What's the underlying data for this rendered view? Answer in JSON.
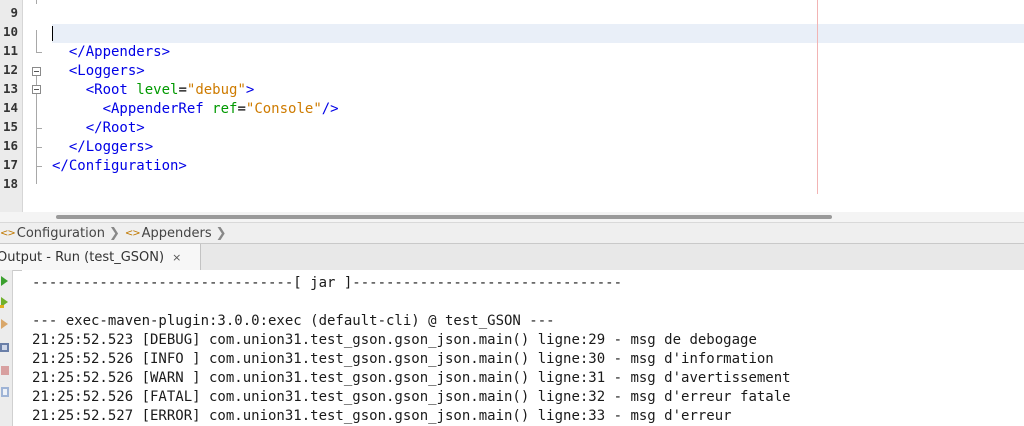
{
  "editor": {
    "line_numbers": [
      "9",
      "10",
      "11",
      "12",
      "13",
      "14",
      "15",
      "16",
      "17",
      "18"
    ],
    "lines": [
      {
        "indent": "",
        "parts": []
      },
      {
        "indent": "",
        "parts": [],
        "caret": true
      },
      {
        "indent": "  ",
        "parts": [
          {
            "c": "tag",
            "t": "</Appenders>"
          }
        ]
      },
      {
        "indent": "  ",
        "parts": [
          {
            "c": "tag",
            "t": "<Loggers>"
          }
        ]
      },
      {
        "indent": "    ",
        "parts": [
          {
            "c": "tag",
            "t": "<Root "
          },
          {
            "c": "attr",
            "t": "level"
          },
          {
            "c": "plain",
            "t": "="
          },
          {
            "c": "val",
            "t": "\"debug\""
          },
          {
            "c": "tag",
            "t": ">"
          }
        ]
      },
      {
        "indent": "      ",
        "parts": [
          {
            "c": "tag",
            "t": "<AppenderRef "
          },
          {
            "c": "attr",
            "t": "ref"
          },
          {
            "c": "plain",
            "t": "="
          },
          {
            "c": "val",
            "t": "\"Console\""
          },
          {
            "c": "tag",
            "t": "/>"
          }
        ]
      },
      {
        "indent": "    ",
        "parts": [
          {
            "c": "tag",
            "t": "</Root>"
          }
        ]
      },
      {
        "indent": "  ",
        "parts": [
          {
            "c": "tag",
            "t": "</Loggers>"
          }
        ]
      },
      {
        "indent": "",
        "parts": [
          {
            "c": "tag",
            "t": "</Configuration>"
          }
        ]
      },
      {
        "indent": "",
        "parts": []
      }
    ]
  },
  "breadcrumb": {
    "items": [
      {
        "icon": "xml-element-icon",
        "label": "Configuration"
      },
      {
        "icon": "xml-element-icon",
        "label": "Appenders"
      }
    ]
  },
  "output": {
    "tab_label": "Output - Run (test_GSON)",
    "close_glyph": "×",
    "lines": [
      "-------------------------------[ jar ]--------------------------------",
      "",
      "--- exec-maven-plugin:3.0.0:exec (default-cli) @ test_GSON ---",
      "21:25:52.523 [DEBUG] com.union31.test_gson.gson_json.main() ligne:29 - msg de debogage",
      "21:25:52.526 [INFO ] com.union31.test_gson.gson_json.main() ligne:30 - msg d'information",
      "21:25:52.526 [WARN ] com.union31.test_gson.gson_json.main() ligne:31 - msg d'avertissement",
      "21:25:52.526 [FATAL] com.union31.test_gson.gson_json.main() ligne:32 - msg d'erreur fatale",
      "21:25:52.527 [ERROR] com.union31.test_gson.gson_json.main() ligne:33 - msg d'erreur"
    ]
  },
  "colors": {
    "tag": "#0000e6",
    "attribute": "#009900",
    "value": "#ce7b00",
    "current_line": "#e9eff8"
  }
}
